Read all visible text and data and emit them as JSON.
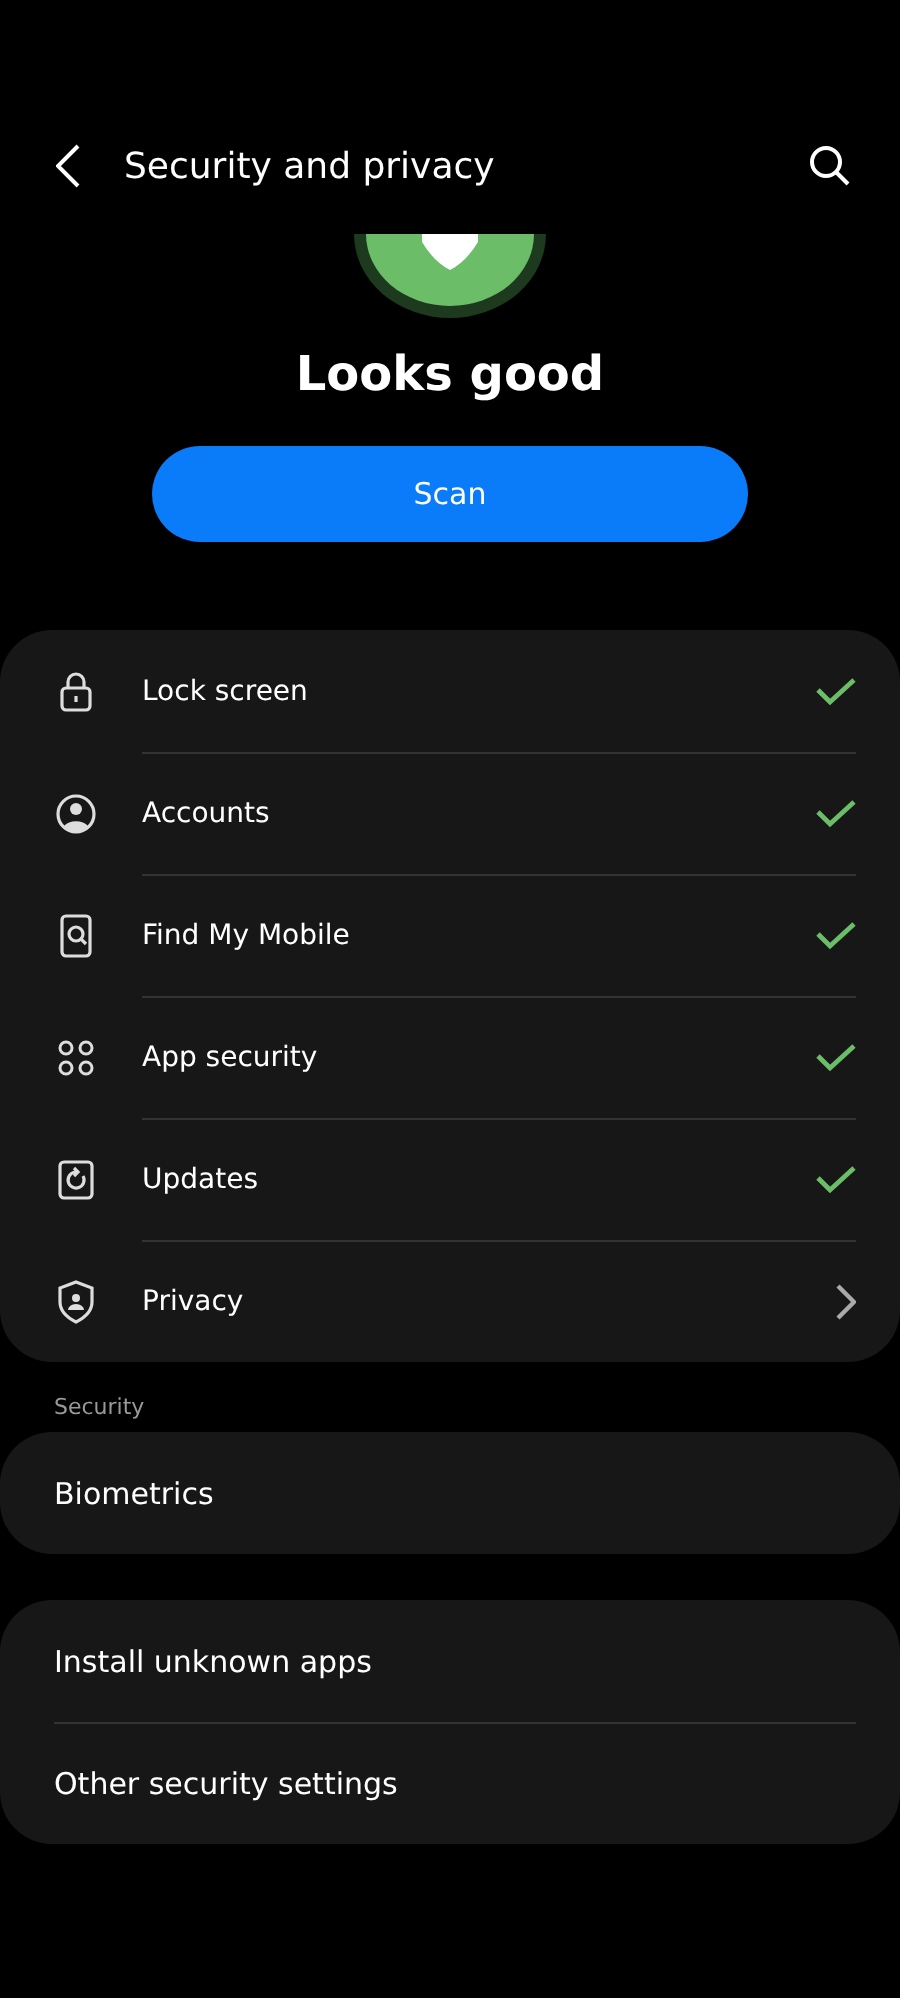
{
  "header": {
    "title": "Security and privacy"
  },
  "status": {
    "title": "Looks good"
  },
  "scan_button": {
    "label": "Scan"
  },
  "checks": [
    {
      "label": "Lock screen",
      "kind": "check"
    },
    {
      "label": "Accounts",
      "kind": "check"
    },
    {
      "label": "Find My Mobile",
      "kind": "check"
    },
    {
      "label": "App security",
      "kind": "check"
    },
    {
      "label": "Updates",
      "kind": "check"
    },
    {
      "label": "Privacy",
      "kind": "link"
    }
  ],
  "sections": [
    {
      "heading": "Security",
      "items": [
        "Biometrics"
      ]
    },
    {
      "items": [
        "Install unknown apps",
        "Other security settings"
      ]
    }
  ]
}
